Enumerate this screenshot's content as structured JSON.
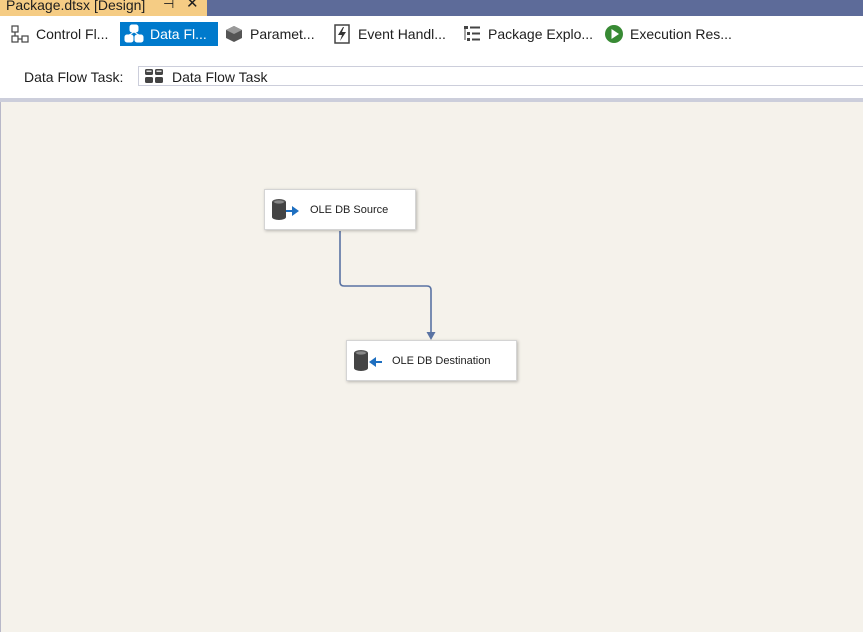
{
  "document_tab": {
    "title": "Package.dtsx [Design]",
    "pin_icon": "pin-icon",
    "close_icon": "close-icon"
  },
  "toolbar": {
    "tabs": [
      {
        "label": "Control Fl...",
        "icon": "control-flow-icon",
        "active": false
      },
      {
        "label": "Data Fl...",
        "icon": "data-flow-icon",
        "active": true
      },
      {
        "label": "Paramet...",
        "icon": "parameters-icon",
        "active": false
      },
      {
        "label": "Event Handl...",
        "icon": "event-handlers-icon",
        "active": false
      },
      {
        "label": "Package Explo...",
        "icon": "package-explorer-icon",
        "active": false
      },
      {
        "label": "Execution Res...",
        "icon": "execution-results-icon",
        "active": false
      }
    ]
  },
  "task_selector": {
    "label": "Data Flow Task:",
    "value": "Data Flow Task",
    "icon": "data-flow-task-icon"
  },
  "canvas": {
    "components": [
      {
        "label": "OLE DB Source",
        "icon": "ole-db-source-icon"
      },
      {
        "label": "OLE DB Destination",
        "icon": "ole-db-destination-icon"
      }
    ],
    "connector": "data-path-arrow"
  },
  "colors": {
    "active_tab": "#007acc",
    "doc_tab": "#f5cc84",
    "tab_strip": "#5d6b99",
    "canvas": "#f5f2eb",
    "connector": "#5a73a3"
  }
}
